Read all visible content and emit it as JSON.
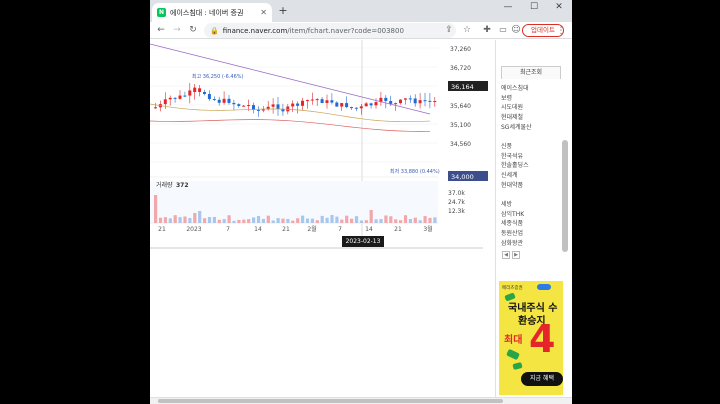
{
  "browser": {
    "tab_title": "에이스침대 : 네이버 증권",
    "favicon_letter": "N",
    "close_glyph": "✕",
    "new_tab_glyph": "+",
    "minimize_glyph": "—",
    "maximize_glyph": "☐",
    "close_window_glyph": "✕",
    "back_glyph": "←",
    "forward_glyph": "→",
    "reload_glyph": "↻",
    "url_host": "finance.naver.com",
    "url_path": "/item/fchart.naver?code=003800",
    "update_label": "업데이트",
    "share_glyph": "⇪",
    "star_glyph": "☆",
    "extensions_glyph": "✚",
    "menu_glyph": "⋮"
  },
  "chart": {
    "price_axis": [
      "37,260",
      "36,720",
      "36,164",
      "35,640",
      "35,100",
      "34,560",
      "34,000"
    ],
    "current_price_label": "36,164",
    "current_price_bottom": "34,000",
    "high_annotation": "최고 36,250 (-6.46%)",
    "low_annotation": "최저 33,880 (0.44%)",
    "volume_label": "거래량",
    "volume_value": "372",
    "volume_axis": [
      "37.0k",
      "24.7k",
      "12.3k"
    ],
    "x_labels": [
      "21",
      "2023",
      "7",
      "14",
      "21",
      "2월",
      "7",
      "14",
      "21",
      "3월"
    ],
    "date_badge": "2023-02-13",
    "colors": {
      "up": "#e4262b",
      "down": "#1e6bd6",
      "ma_gold": "#c8a050",
      "ma_purple": "#9c6cc7",
      "ma_red": "#d96060"
    }
  },
  "sidebar": {
    "recent_tab": "최근조회",
    "items_group1": [
      "에이스침대",
      "보령",
      "시도데원",
      "현대제철",
      "SG세계물산"
    ],
    "items_group2": [
      "신풍",
      "한국석유",
      "한솔홀딩스",
      "신세계",
      "현대약품"
    ],
    "items_group3": [
      "세방",
      "삼익THK",
      "세종식품",
      "동원산업",
      "삼화왕관"
    ],
    "pager": [
      "◀",
      "▶"
    ]
  },
  "ad": {
    "brand": "메리츠증권",
    "line1": "국내주식 수",
    "line2": "환승지",
    "line3": "최대",
    "big": "4",
    "cta": "지금 혜택"
  }
}
